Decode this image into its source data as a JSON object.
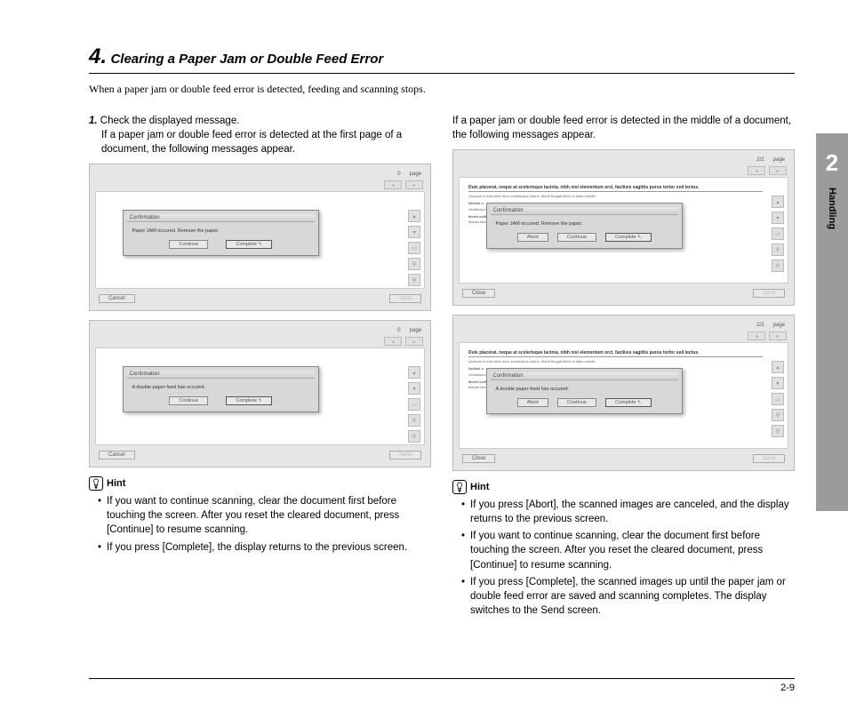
{
  "section": {
    "number": "4.",
    "title": "Clearing a Paper Jam or Double Feed Error"
  },
  "intro": "When a paper jam or double feed error is detected, feeding and scanning stops.",
  "left": {
    "step_number": "1.",
    "step_title": "Check the displayed message.",
    "step_body": "If a paper jam or double feed error is detected at the first page of a document, the following messages appear.",
    "ss1": {
      "page_count": "0",
      "page_label": "page",
      "dialog_title": "Confirmation",
      "dialog_msg": "Paper JAM occured. Remove the paper.",
      "btn_continue": "Continue",
      "btn_complete": "Complete",
      "btn_cancel": "Cancel",
      "btn_send": "Send"
    },
    "ss2": {
      "page_count": "0",
      "page_label": "page",
      "dialog_title": "Confirmation",
      "dialog_msg": "A double paper-feed has occured.",
      "btn_continue": "Continue",
      "btn_complete": "Complete",
      "btn_cancel": "Cancel",
      "btn_send": "Send"
    },
    "hint_label": "Hint",
    "hints": [
      "If you want to continue scanning, clear the document first before touching the screen. After you reset the cleared document, press [Continue] to resume scanning.",
      "If you press [Complete], the display returns to the previous screen."
    ]
  },
  "right": {
    "intro": "If a paper jam or double feed error is detected in the middle of a document, the following messages appear.",
    "ss3": {
      "page_count": "2/2",
      "page_label": "page",
      "dialog_title": "Confirmation",
      "dialog_msg": "Paper JAM occured. Remove the paper.",
      "btn_abort": "Abort",
      "btn_continue": "Continue",
      "btn_complete": "Complete",
      "btn_close": "Close",
      "btn_send": "Send"
    },
    "ss4": {
      "page_count": "2/2",
      "page_label": "page",
      "dialog_title": "Confirmation",
      "dialog_msg": "A double paper-feed has occured.",
      "btn_abort": "Abort",
      "btn_continue": "Continue",
      "btn_complete": "Complete",
      "btn_close": "Close",
      "btn_send": "Send"
    },
    "hint_label": "Hint",
    "hints": [
      "If you press [Abort], the scanned images are canceled, and the display returns to the previous screen.",
      "If you want to continue scanning, clear the document first before touching the screen. After you reset the cleared document, press [Continue] to resume scanning.",
      "If you press [Complete], the scanned images up until the paper jam or double feed error are saved and scanning completes. The display switches to the Send screen."
    ]
  },
  "sidebar": {
    "chapter": "2",
    "label": "Handling"
  },
  "footer": {
    "page": "2-9"
  }
}
